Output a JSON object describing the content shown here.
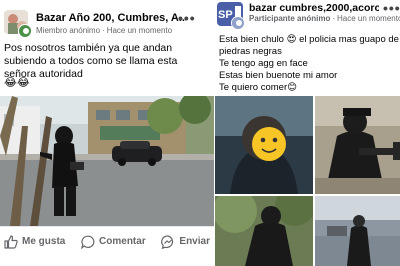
{
  "left": {
    "group_title": "Bazar Año 200, Cumbres, A...",
    "author": "Miembro anónimo",
    "time": "Hace un momento",
    "text": "Pos nosotros también ya que andan subiendo a todos como se llama esta señora autoridad",
    "reactions": "😂😂",
    "actions": {
      "like": "Me gusta",
      "comment": "Comentar",
      "share": "Enviar"
    }
  },
  "right": {
    "group_title": "bazar cumbres,2000,acoro...",
    "author": "Participante anónimo",
    "time": "Hace un momento",
    "lines": [
      "Esta bien chulo 😍 el policia mas guapo de piedras negras",
      "Te tengo agg en face",
      "Estas bien buenote mi amor",
      "Te quiero comer😊"
    ]
  },
  "colors": {
    "accent": "#1b74e4",
    "muted": "#65676b"
  }
}
